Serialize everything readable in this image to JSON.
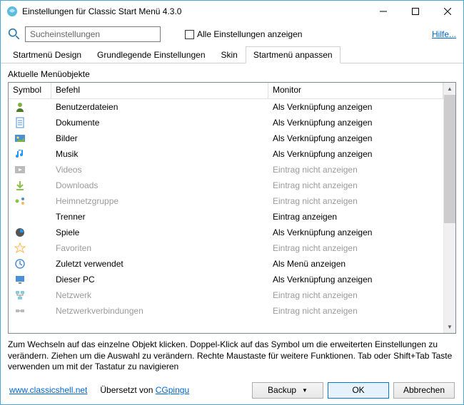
{
  "window": {
    "title": "Einstellungen für Classic Start Menü 4.3.0"
  },
  "toolbar": {
    "search_placeholder": "Sucheinstellungen",
    "show_all_label": "Alle Einstellungen anzeigen",
    "help_label": "Hilfe..."
  },
  "tabs": {
    "items": [
      {
        "label": "Startmenü Design"
      },
      {
        "label": "Grundlegende Einstellungen"
      },
      {
        "label": "Skin"
      },
      {
        "label": "Startmenü anpassen"
      }
    ]
  },
  "content": {
    "section_title": "Aktuelle Menüobjekte",
    "columns": {
      "symbol": "Symbol",
      "befehl": "Befehl",
      "monitor": "Monitor"
    },
    "rows": [
      {
        "icon": "user",
        "befehl": "Benutzerdateien",
        "monitor": "Als Verknüpfung anzeigen",
        "disabled": false
      },
      {
        "icon": "doc",
        "befehl": "Dokumente",
        "monitor": "Als Verknüpfung anzeigen",
        "disabled": false
      },
      {
        "icon": "picture",
        "befehl": "Bilder",
        "monitor": "Als Verknüpfung anzeigen",
        "disabled": false
      },
      {
        "icon": "music",
        "befehl": "Musik",
        "monitor": "Als Verknüpfung anzeigen",
        "disabled": false
      },
      {
        "icon": "video",
        "befehl": "Videos",
        "monitor": "Eintrag nicht anzeigen",
        "disabled": true
      },
      {
        "icon": "download",
        "befehl": "Downloads",
        "monitor": "Eintrag nicht anzeigen",
        "disabled": true
      },
      {
        "icon": "homegroup",
        "befehl": "Heimnetzgruppe",
        "monitor": "Eintrag nicht anzeigen",
        "disabled": true
      },
      {
        "icon": "",
        "befehl": "Trenner",
        "monitor": "Eintrag anzeigen",
        "disabled": false
      },
      {
        "icon": "games",
        "befehl": "Spiele",
        "monitor": "Als Verknüpfung anzeigen",
        "disabled": false
      },
      {
        "icon": "star",
        "befehl": "Favoriten",
        "monitor": "Eintrag nicht anzeigen",
        "disabled": true
      },
      {
        "icon": "recent",
        "befehl": "Zuletzt verwendet",
        "monitor": "Als Menü anzeigen",
        "disabled": false
      },
      {
        "icon": "pc",
        "befehl": "Dieser PC",
        "monitor": "Als Verknüpfung anzeigen",
        "disabled": false
      },
      {
        "icon": "network",
        "befehl": "Netzwerk",
        "monitor": "Eintrag nicht anzeigen",
        "disabled": true
      },
      {
        "icon": "netconn",
        "befehl": "Netzwerkverbindungen",
        "monitor": "Eintrag nicht anzeigen",
        "disabled": true
      }
    ],
    "hint": "Zum Wechseln auf das einzelne Objekt klicken. Doppel-Klick auf das Symbol um die erweiterten Einstellungen zu verändern. Ziehen um die Auswahl zu verändern. Rechte Maustaste für weitere Funktionen. Tab oder Shift+Tab Taste verwenden um mit der Tastatur zu navigieren"
  },
  "footer": {
    "url_label": "www.classicshell.net",
    "credit_prefix": "Übersetzt von ",
    "credit_link": "CGpingu",
    "backup_label": "Backup",
    "ok_label": "OK",
    "cancel_label": "Abbrechen"
  }
}
